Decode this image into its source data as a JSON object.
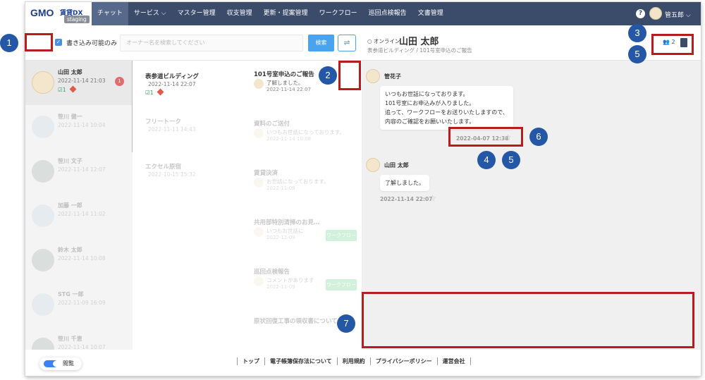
{
  "header": {
    "logo_text": "GMO",
    "logo_sub": "賃貸DX",
    "env_badge": "staging",
    "nav": [
      {
        "label": "チャット"
      },
      {
        "label": "サービス ⌵"
      },
      {
        "label": "マスター管理"
      },
      {
        "label": "収支管理"
      },
      {
        "label": "更新・提案管理"
      },
      {
        "label": "ワークフロー"
      },
      {
        "label": "巡回点検報告"
      },
      {
        "label": "文書管理"
      }
    ],
    "help": "?",
    "user_name": "管五郎 ⌵"
  },
  "toolbar": {
    "writable_only": "書き込み可能のみ",
    "search_placeholder": "オーナー名を検索してください",
    "search_button": "検索"
  },
  "contacts": [
    {
      "name": "山田 太郎",
      "time": "2022-11-14 21:03",
      "status": "☑1",
      "badge": "1"
    },
    {
      "name": "笹川 健一",
      "time": "2022-11-14 10:04",
      "status": "",
      "badge": ""
    },
    {
      "name": "笹川 文子",
      "time": "2022-11-14 12:07",
      "status": "",
      "badge": ""
    },
    {
      "name": "加藤 一郎",
      "time": "2022-11-14 11:02",
      "status": "",
      "badge": ""
    },
    {
      "name": "鈴木 太郎",
      "time": "2022-11-14 10:08",
      "status": "",
      "badge": ""
    },
    {
      "name": "STG 一郎",
      "time": "2022-11-09 16:09",
      "status": "",
      "badge": ""
    },
    {
      "name": "笹川 千恵",
      "time": "2022-11-14 10:07",
      "status": "",
      "badge": ""
    }
  ],
  "buildings": [
    {
      "name": "表参道ビルディング",
      "time": "2022-11-14 22:07",
      "status": "☑1"
    },
    {
      "name": "フリートーク",
      "time": "2022-11-11 14:43",
      "status": ""
    },
    {
      "name": "エクセル原宿",
      "time": "2022-10-15 15:32",
      "status": ""
    }
  ],
  "rooms": [
    {
      "name": "101号室申込のご報告",
      "msg": "了解しました。",
      "time": "2022-11-14 22:07",
      "wf": ""
    },
    {
      "name": "資料のご送付",
      "msg": "いつもお世話になっております。",
      "time": "2022-11-14 10:08",
      "wf": ""
    },
    {
      "name": "賃貸決済",
      "msg": "お世話になっております。",
      "time": "2022-11-09",
      "wf": ""
    },
    {
      "name": "共用部特別清掃のお見…",
      "msg": "いつもお世話に",
      "time": "2022-11-09",
      "wf": "ワークフロー"
    },
    {
      "name": "巡回点検報告",
      "msg": "コメントがあります",
      "time": "2022-11-09",
      "wf": "ワークフロー"
    },
    {
      "name": "原状回復工事の領収書について",
      "msg": "",
      "time": "",
      "wf": ""
    }
  ],
  "chat": {
    "status": "○ オンライン",
    "title": "山田 太郎",
    "subtitle": "表参道ビルディング / 101号室申込のご報告",
    "member_count": "2",
    "messages": [
      {
        "sender": "管花子",
        "lines": [
          "いつもお世話になっております。",
          "101号室にお申込みが入りました。",
          "追って、ワークフローをお送りいたしますので、",
          "内容のご確認をお願いいたします。"
        ],
        "time": "2022-04-07 12:38"
      },
      {
        "sender": "山田 太郎",
        "lines": [
          "了解しました。"
        ],
        "time": "2022-11-14 22:07"
      }
    ]
  },
  "footer": {
    "toggle_label": "閲覧",
    "links": [
      "トップ",
      "電子帳簿保存法について",
      "利用規約",
      "プライバシーポリシー",
      "運営会社"
    ]
  },
  "annotations": [
    "1",
    "2",
    "3",
    "5",
    "6",
    "4",
    "5",
    "7"
  ],
  "colors": {
    "header_bg": "#3b4c6b",
    "annotation_box": "#b81c1c",
    "marker": "#2457a5",
    "accent": "#4aa3ef"
  }
}
